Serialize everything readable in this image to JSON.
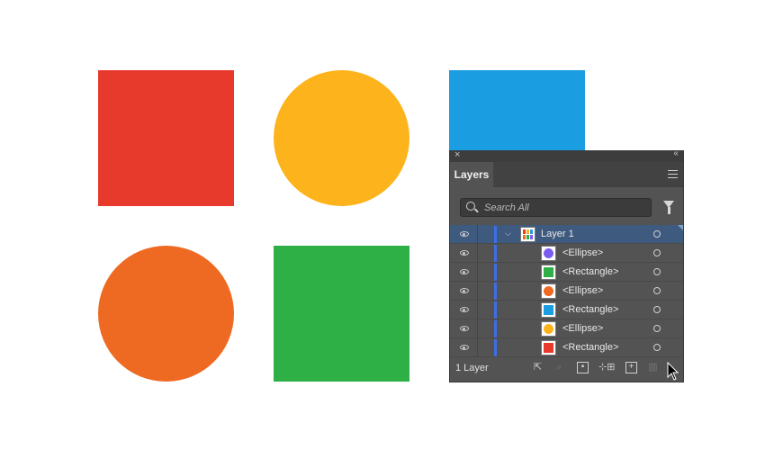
{
  "canvas": {
    "shapes": [
      {
        "name": "red-rectangle",
        "kind": "rectangle",
        "color": "#e8392d"
      },
      {
        "name": "yellow-ellipse",
        "kind": "ellipse",
        "color": "#fdb31b"
      },
      {
        "name": "blue-rectangle",
        "kind": "rectangle",
        "color": "#1b9de2"
      },
      {
        "name": "orange-ellipse",
        "kind": "ellipse",
        "color": "#ee6a23"
      },
      {
        "name": "green-rectangle",
        "kind": "rectangle",
        "color": "#2fb046"
      }
    ]
  },
  "panel": {
    "tab_label": "Layers",
    "close_icon": "close-icon",
    "collapse_icon": "collapse-icon",
    "menu_icon": "panel-menu-icon",
    "search_placeholder": "Search All",
    "filter_icon": "filter-icon",
    "layer": {
      "name": "Layer 1",
      "color": "#3d6ee6",
      "expanded": true
    },
    "items": [
      {
        "name": "<Ellipse>",
        "color": "#7b5cf0",
        "shape": "ellipse"
      },
      {
        "name": "<Rectangle>",
        "color": "#2fb046",
        "shape": "rectangle"
      },
      {
        "name": "<Ellipse>",
        "color": "#ee6a23",
        "shape": "ellipse"
      },
      {
        "name": "<Rectangle>",
        "color": "#1b9de2",
        "shape": "rectangle"
      },
      {
        "name": "<Ellipse>",
        "color": "#fdb31b",
        "shape": "ellipse"
      },
      {
        "name": "<Rectangle>",
        "color": "#e8392d",
        "shape": "rectangle"
      }
    ],
    "footer": {
      "count_label": "1 Layer",
      "buttons": [
        "export-icon",
        "locate-object-icon",
        "clipping-mask-icon",
        "sublayer-icon",
        "new-layer-icon",
        "delete-icon"
      ]
    }
  },
  "colors": {
    "panel_bg": "#535353",
    "selection": "#3f5a7f",
    "layer_color": "#3d6ee6"
  }
}
